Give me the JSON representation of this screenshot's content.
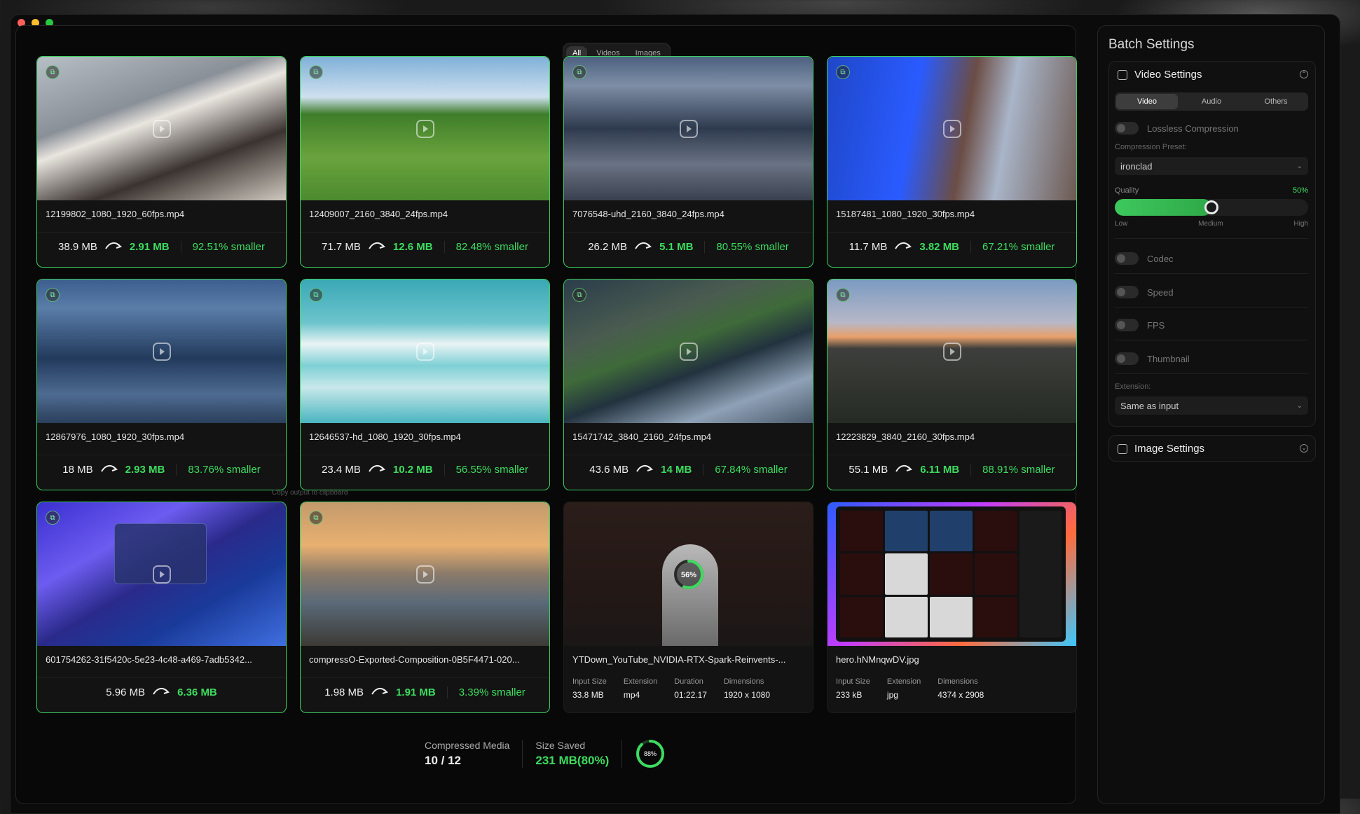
{
  "filter_tabs": [
    "All",
    "Videos",
    "Images"
  ],
  "copy_hint": "Copy output to clipboard",
  "cards": [
    {
      "name": "12199802_1080_1920_60fps.mp4",
      "input": "38.9 MB",
      "output": "2.91 MB",
      "pct": "92.51% smaller"
    },
    {
      "name": "12409007_2160_3840_24fps.mp4",
      "input": "71.7 MB",
      "output": "12.6 MB",
      "pct": "82.48% smaller"
    },
    {
      "name": "7076548-uhd_2160_3840_24fps.mp4",
      "input": "26.2 MB",
      "output": "5.1 MB",
      "pct": "80.55% smaller"
    },
    {
      "name": "15187481_1080_1920_30fps.mp4",
      "input": "11.7 MB",
      "output": "3.82 MB",
      "pct": "67.21% smaller"
    },
    {
      "name": "12867976_1080_1920_30fps.mp4",
      "input": "18 MB",
      "output": "2.93 MB",
      "pct": "83.76% smaller"
    },
    {
      "name": "12646537-hd_1080_1920_30fps.mp4",
      "input": "23.4 MB",
      "output": "10.2 MB",
      "pct": "56.55% smaller"
    },
    {
      "name": "15471742_3840_2160_24fps.mp4",
      "input": "43.6 MB",
      "output": "14 MB",
      "pct": "67.84% smaller"
    },
    {
      "name": "12223829_3840_2160_30fps.mp4",
      "input": "55.1 MB",
      "output": "6.11 MB",
      "pct": "88.91% smaller"
    },
    {
      "name": "601754262-31f5420c-5e23-4c48-a469-7adb5342...",
      "input": "5.96 MB",
      "output": "6.36 MB"
    },
    {
      "name": "compressO-Exported-Composition-0B5F4471-020...",
      "input": "1.98 MB",
      "output": "1.91 MB",
      "pct": "3.39% smaller"
    },
    {
      "name": "YTDown_YouTube_NVIDIA-RTX-Spark-Reinvents-...",
      "progress_label": "56%",
      "progress": 0.56,
      "meta": [
        {
          "label": "Input Size",
          "value": "33.8 MB"
        },
        {
          "label": "Extension",
          "value": "mp4"
        },
        {
          "label": "Duration",
          "value": "01:22.17"
        },
        {
          "label": "Dimensions",
          "value": "1920 x 1080"
        }
      ]
    },
    {
      "name": "hero.hNMnqwDV.jpg",
      "meta": [
        {
          "label": "Input Size",
          "value": "233 kB"
        },
        {
          "label": "Extension",
          "value": "jpg"
        },
        {
          "label": "Dimensions",
          "value": "4374 x 2908"
        }
      ]
    }
  ],
  "summary": {
    "compressed_label": "Compressed Media",
    "compressed_value": "10 / 12",
    "saved_label": "Size Saved",
    "saved_value": "231 MB(80%)",
    "ring_label": "88%",
    "ring_progress": 0.88
  },
  "sidebar": {
    "title": "Batch Settings",
    "video_settings": {
      "title": "Video Settings",
      "tabs": [
        "Video",
        "Audio",
        "Others"
      ],
      "lossless_label": "Lossless Compression",
      "preset_label": "Compression Preset:",
      "preset_value": "ironclad",
      "quality_label": "Quality",
      "quality_value": "50%",
      "quality_level": 0.5,
      "quality_low": "Low",
      "quality_mid": "Medium",
      "quality_high": "High",
      "codec_label": "Codec",
      "speed_label": "Speed",
      "fps_label": "FPS",
      "thumbnail_label": "Thumbnail",
      "extension_label": "Extension:",
      "extension_value": "Same as input"
    },
    "image_settings": {
      "title": "Image Settings"
    }
  },
  "colors": {
    "accent_green": "#3ddc5f",
    "border_green": "#3ccf5e",
    "background": "#0b0b0b"
  }
}
